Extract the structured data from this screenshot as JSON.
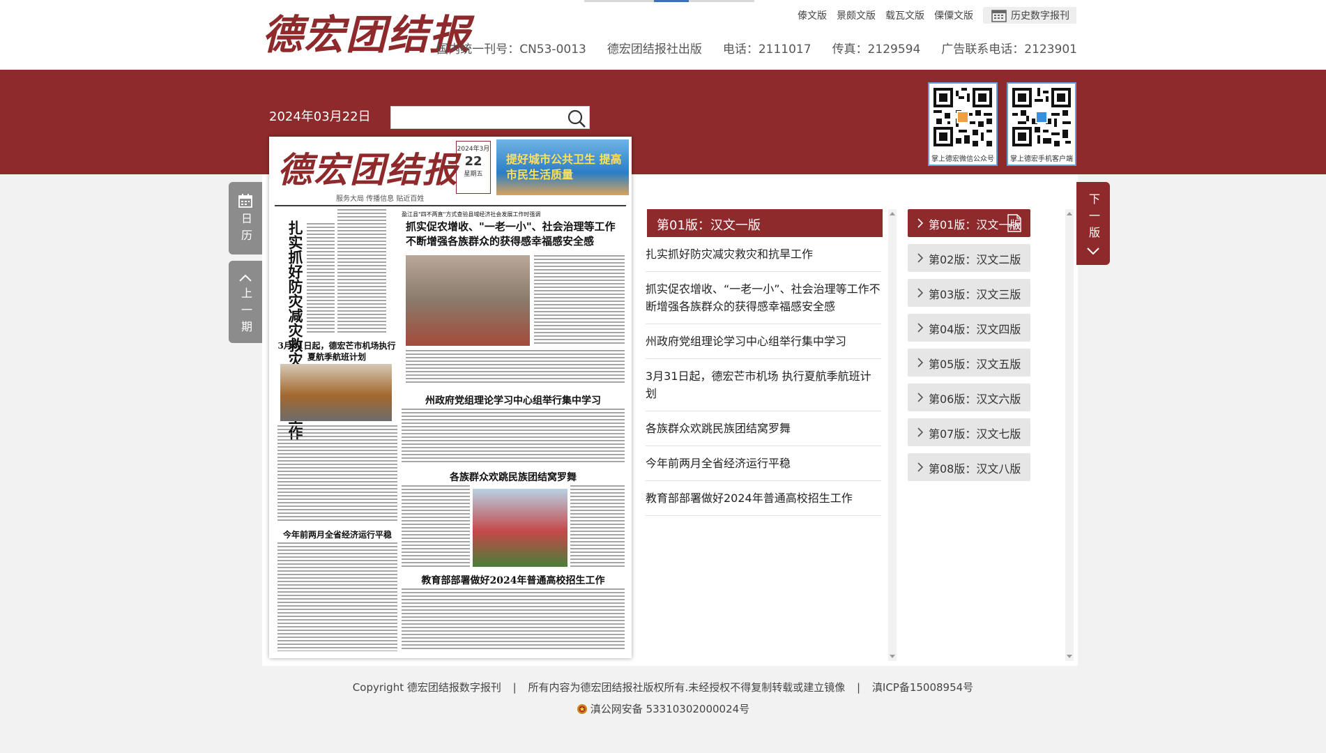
{
  "header": {
    "logo": "德宏团结报",
    "lang_links": [
      "傣文版",
      "景颇文版",
      "载瓦文版",
      "傈僳文版"
    ],
    "archive_label": "历史数字报刊",
    "info": [
      "国内统一刊号：CN53-0013",
      "德宏团结报社出版",
      "电话：2111017",
      "传真：2129594",
      "广告联系电话：2123901"
    ]
  },
  "toolbar": {
    "date": "2024年03月22日",
    "search_value": "",
    "search_placeholder": ""
  },
  "qr_codes": [
    {
      "caption": "掌上德宏微信公众号"
    },
    {
      "caption": "掌上德宏手机客户端"
    }
  ],
  "side": {
    "calendar": "日历",
    "prev": "上一期",
    "next": "下一版"
  },
  "newspaper": {
    "title": "德宏团结报",
    "subtitle": "服务大局  传播信息  贴近百姓",
    "day": "22",
    "banner": "提好城市公共卫生 提高市民生活质量",
    "headlines": {
      "h1_prefix": "盈江县\"四不两直\"方式查验县域经济社会发展工作时强调",
      "h1": "抓实促农增收、\"一老一小\"、社会治理等工作",
      "h1b": "不断增强各族群众的获得感幸福感安全感",
      "v1": "扎实抓好防灾减灾救灾和抗旱工作",
      "airport": "3月31日起，德宏芒市机场执行夏航季航班计划",
      "study": "州政府党组理论学习中心组举行集中学习",
      "dance": "各族群众欢跳民族团结窝罗舞",
      "economy": "今年前两月全省经济运行平稳",
      "exam": "教育部部署做好2024年普通高校招生工作"
    }
  },
  "articles": {
    "section_title": "第01版：汉文一版",
    "items": [
      "扎实抓好防灾减灾救灾和抗旱工作",
      "抓实促农增收、“一老一小”、社会治理等工作不断增强各族群众的获得感幸福感安全感",
      "州政府党组理论学习中心组举行集中学习",
      "3月31日起，德宏芒市机场 执行夏航季航班计划",
      "各族群众欢跳民族团结窝罗舞",
      "今年前两月全省经济运行平稳",
      "教育部部署做好2024年普通高校招生工作"
    ]
  },
  "pages": [
    "第01版：汉文一版",
    "第02版：汉文二版",
    "第03版：汉文三版",
    "第04版：汉文四版",
    "第05版：汉文五版",
    "第06版：汉文六版",
    "第07版：汉文七版",
    "第08版：汉文八版"
  ],
  "footer": {
    "copyright": "Copyright 德宏团结报数字报刊",
    "rights": "所有内容为德宏团结报社版权所有.未经授权不得复制转载或建立镜像",
    "icp": "滇ICP备15008954号",
    "police": "滇公网安备 53310302000024号",
    "sep": "|"
  },
  "colors": {
    "brand": "#8e2a2b",
    "tab_inactive": "#e6e6e6",
    "side_tab": "#8c8c8c"
  }
}
